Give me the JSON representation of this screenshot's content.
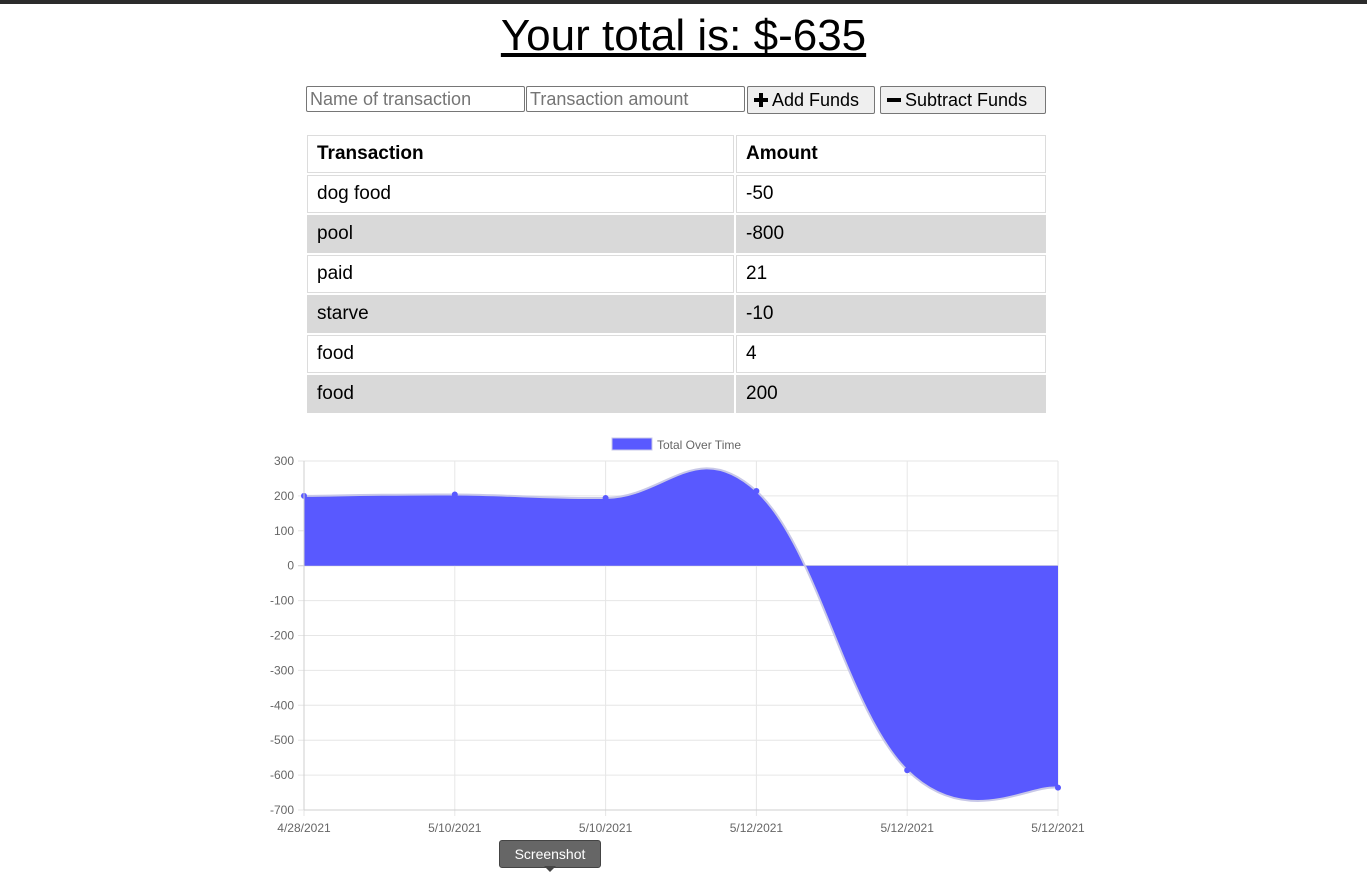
{
  "header": {
    "total_text": "Your total is: $-635"
  },
  "form": {
    "name_placeholder": "Name of transaction",
    "amount_placeholder": "Transaction amount",
    "add_label": "Add Funds",
    "subtract_label": "Subtract Funds",
    "add_icon": "plus-icon",
    "subtract_icon": "minus-icon"
  },
  "table": {
    "headers": [
      "Transaction",
      "Amount"
    ],
    "rows": [
      {
        "name": "dog food",
        "amount": "-50"
      },
      {
        "name": "pool",
        "amount": "-800"
      },
      {
        "name": "paid",
        "amount": "21"
      },
      {
        "name": "starve",
        "amount": "-10"
      },
      {
        "name": "food",
        "amount": "4"
      },
      {
        "name": "food",
        "amount": "200"
      }
    ]
  },
  "chart_data": {
    "type": "area",
    "title": "",
    "legend": {
      "label": "Total Over Time",
      "position": "top-center"
    },
    "categories": [
      "4/28/2021",
      "5/10/2021",
      "5/10/2021",
      "5/12/2021",
      "5/12/2021",
      "5/12/2021"
    ],
    "series": [
      {
        "name": "Total Over Time",
        "values": [
          200,
          204,
          194,
          214,
          -586,
          -636
        ]
      }
    ],
    "ylim": [
      -700,
      300
    ],
    "yticks": [
      300,
      200,
      100,
      0,
      -100,
      -200,
      -300,
      -400,
      -500,
      -600,
      -700
    ],
    "grid": true,
    "fill_color": "#5959ff",
    "line_color": "#c8c8e8"
  },
  "overlay": {
    "tooltip_text": "Screenshot"
  },
  "colors": {
    "row_alt": "#d9d9d9",
    "button_bg": "#efefef"
  }
}
